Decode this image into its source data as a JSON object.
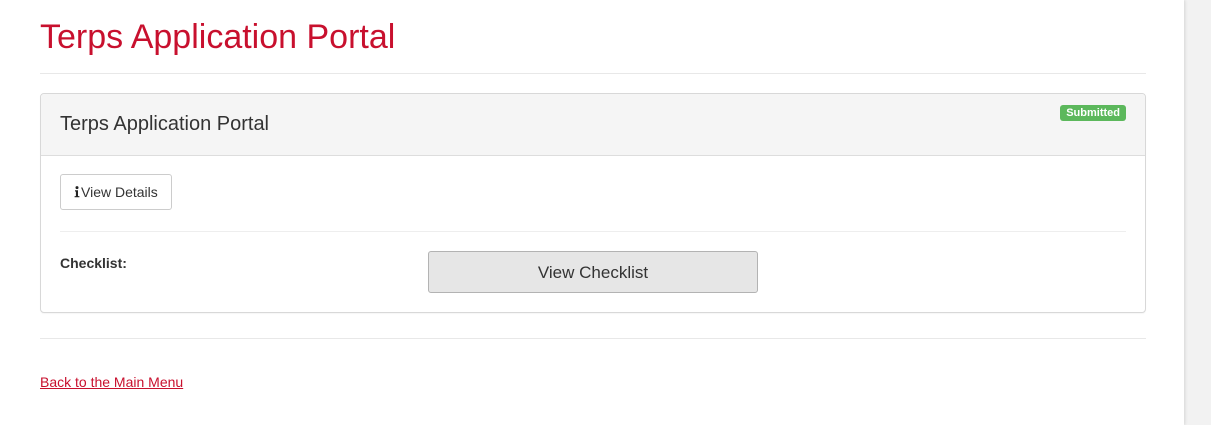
{
  "header": {
    "title": "Terps Application Portal"
  },
  "application_panel": {
    "title": "Terps Application Portal",
    "status_badge": "Submitted",
    "view_details_label": "View Details",
    "checklist_label": "Checklist:",
    "view_checklist_label": "View Checklist"
  },
  "footer": {
    "back_link": "Back to the Main Menu"
  },
  "icons": {
    "details_icon": "info-icon"
  },
  "colors": {
    "brand_red": "#c8102e",
    "status_green": "#5cb85c"
  }
}
